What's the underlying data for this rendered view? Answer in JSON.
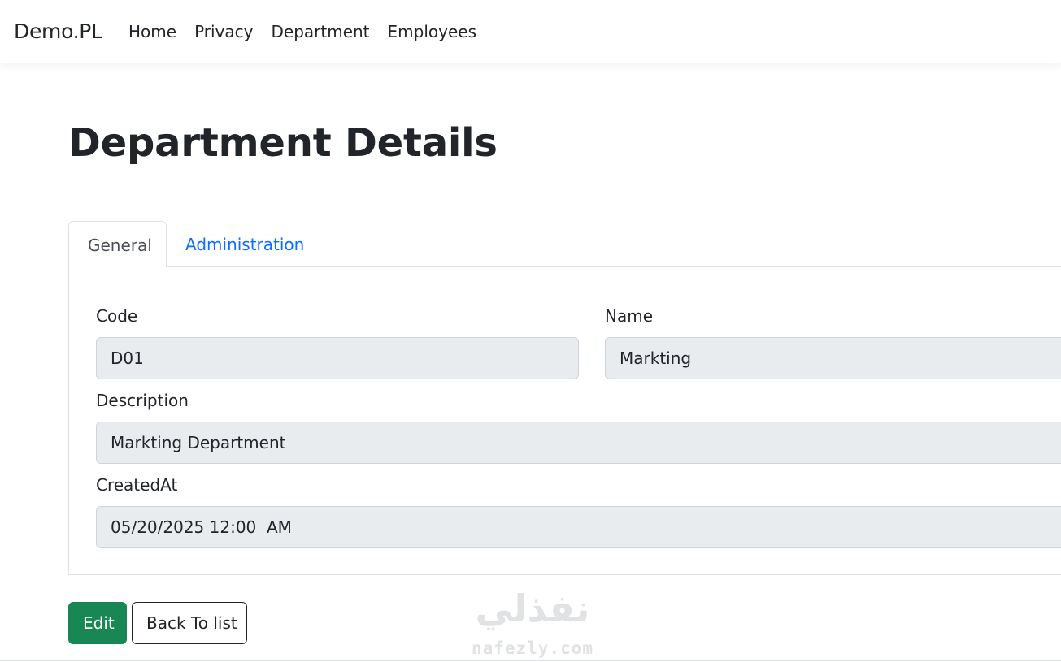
{
  "navbar": {
    "brand": "Demo.PL",
    "links": [
      "Home",
      "Privacy",
      "Department",
      "Employees"
    ]
  },
  "page": {
    "title": "Department Details"
  },
  "tabs": [
    {
      "label": "General",
      "active": true
    },
    {
      "label": "Administration",
      "active": false
    }
  ],
  "form": {
    "code_label": "Code",
    "code_value": "D01",
    "name_label": "Name",
    "name_value": "Markting",
    "description_label": "Description",
    "description_value": "Markting Department",
    "created_label": "CreatedAt",
    "created_value": "05/20/2025 12:00  AM"
  },
  "actions": {
    "edit_label": "Edit",
    "back_label": "Back To list"
  },
  "watermark": {
    "arabic": "نفذلي",
    "latin": "nafezly.com"
  },
  "colors": {
    "link": "#0d6efd",
    "edit_button": "#198754",
    "readonly_field": "#e9ecef"
  }
}
